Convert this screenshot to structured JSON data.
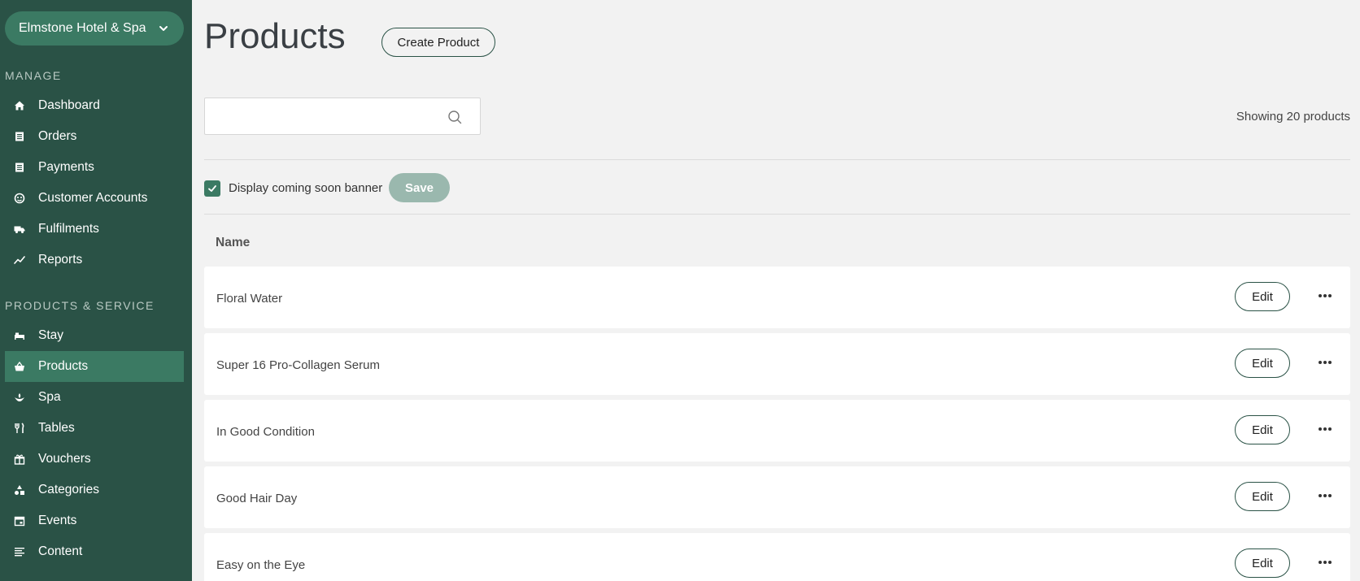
{
  "sidebar": {
    "venue": "Elmstone Hotel & Spa",
    "manage_title": "MANAGE",
    "manage_items": [
      {
        "label": "Dashboard",
        "icon": "home-icon"
      },
      {
        "label": "Orders",
        "icon": "document-icon"
      },
      {
        "label": "Payments",
        "icon": "document-icon"
      },
      {
        "label": "Customer Accounts",
        "icon": "user-circle-icon"
      },
      {
        "label": "Fulfilments",
        "icon": "truck-icon"
      },
      {
        "label": "Reports",
        "icon": "chart-line-icon"
      }
    ],
    "products_title": "PRODUCTS & SERVICE",
    "products_items": [
      {
        "label": "Stay",
        "icon": "bed-icon"
      },
      {
        "label": "Products",
        "icon": "basket-icon",
        "active": true
      },
      {
        "label": "Spa",
        "icon": "spa-icon"
      },
      {
        "label": "Tables",
        "icon": "cutlery-icon"
      },
      {
        "label": "Vouchers",
        "icon": "gift-icon"
      },
      {
        "label": "Categories",
        "icon": "shapes-icon"
      },
      {
        "label": "Events",
        "icon": "calendar-icon"
      },
      {
        "label": "Content",
        "icon": "text-lines-icon"
      }
    ]
  },
  "header": {
    "title": "Products",
    "create_label": "Create Product"
  },
  "search": {
    "value": "",
    "placeholder": ""
  },
  "showing_text": "Showing 20 products",
  "banner": {
    "checked": true,
    "label": "Display coming soon banner",
    "save_label": "Save"
  },
  "table": {
    "column_name": "Name",
    "edit_label": "Edit",
    "rows": [
      {
        "name": "Floral Water"
      },
      {
        "name": "Super 16 Pro-Collagen Serum"
      },
      {
        "name": "In Good Condition"
      },
      {
        "name": "Good Hair Day"
      },
      {
        "name": "Easy on the Eye"
      }
    ]
  },
  "colors": {
    "sidebar_bg": "#2a5246",
    "active_bg": "#3b7a63",
    "save_disabled": "#9ab8ae"
  }
}
